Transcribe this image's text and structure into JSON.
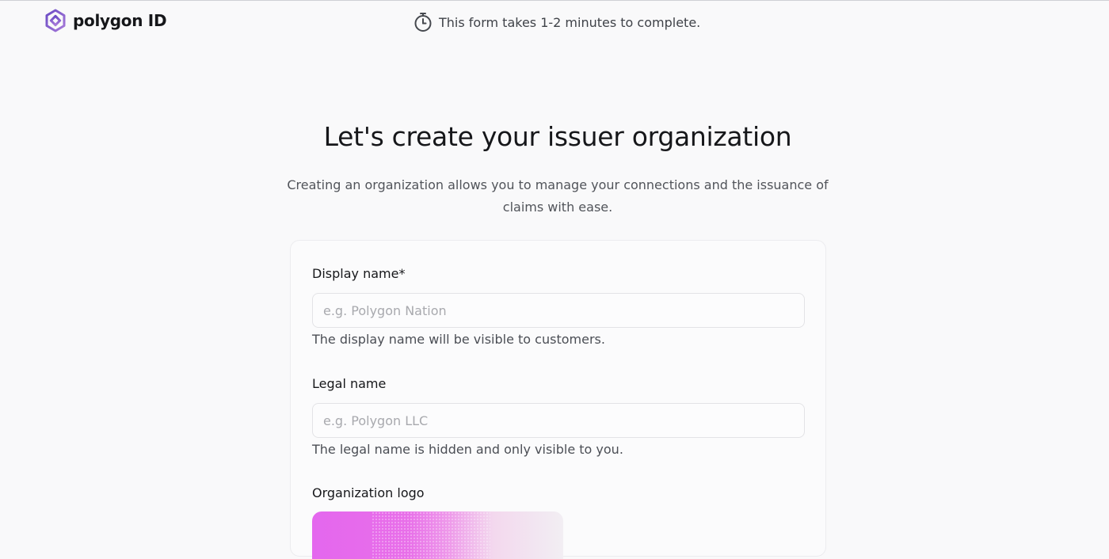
{
  "header": {
    "brand_name": "polygon ID",
    "timer_icon": "stopwatch-icon",
    "timer_text": "This form takes 1-2 minutes to complete."
  },
  "main": {
    "title": "Let's create your issuer organization",
    "subtitle": "Creating an organization allows you to manage your connections and the issuance of claims with ease."
  },
  "form": {
    "display_name": {
      "label": "Display name*",
      "placeholder": "e.g. Polygon Nation",
      "value": "",
      "help": "The display name will be visible to customers."
    },
    "legal_name": {
      "label": "Legal name",
      "placeholder": "e.g. Polygon LLC",
      "value": "",
      "help": "The legal name is hidden and only visible to you."
    },
    "logo": {
      "label": "Organization logo"
    }
  },
  "colors": {
    "brand_purple": "#8a5bd6",
    "logo_gradient_start": "#e467ee",
    "logo_gradient_end": "#f2eef3",
    "text_primary": "#16171a",
    "text_secondary": "#51545a"
  }
}
